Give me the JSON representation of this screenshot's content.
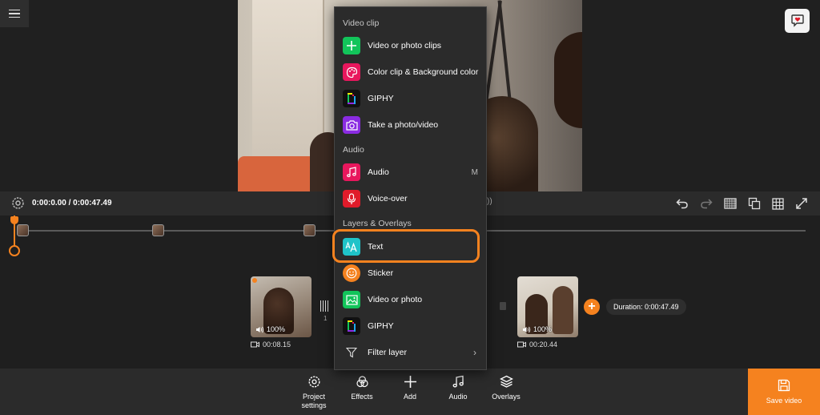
{
  "app": {
    "accent_color": "#f5821f"
  },
  "controls": {
    "time": "0:00:0.00 / 0:00:47.49",
    "volume_hint": "))"
  },
  "timeline": {
    "clips": [
      {
        "volume": "100%",
        "duration": "00:08.15"
      },
      {
        "volume": "100%",
        "duration": "00:20.44"
      }
    ],
    "transition_number": "1",
    "duration_label": "Duration: 0:00:47.49"
  },
  "add_menu": {
    "sections": [
      {
        "header": "Video clip",
        "items": [
          {
            "label": "Video or photo clips",
            "icon": "plus-icon",
            "color": "#12c45a"
          },
          {
            "label": "Color clip & Background color",
            "icon": "palette-icon",
            "color": "#e8175d"
          },
          {
            "label": "GIPHY",
            "icon": "giphy-icon",
            "color": "#111111"
          },
          {
            "label": "Take a photo/video",
            "icon": "camera-icon",
            "color": "#8a2be2"
          }
        ]
      },
      {
        "header": "Audio",
        "items": [
          {
            "label": "Audio",
            "icon": "music-note-icon",
            "color": "#e8175d",
            "shortcut": "M"
          },
          {
            "label": "Voice-over",
            "icon": "microphone-icon",
            "color": "#e01b2a"
          }
        ]
      },
      {
        "header": "Layers & Overlays",
        "items": [
          {
            "label": "Text",
            "icon": "text-icon",
            "color": "#1fc3c9"
          },
          {
            "label": "Sticker",
            "icon": "smiley-icon",
            "color": "#f5821f"
          },
          {
            "label": "Video or photo",
            "icon": "image-icon",
            "color": "#12c45a"
          },
          {
            "label": "GIPHY",
            "icon": "giphy-icon",
            "color": "#111111"
          },
          {
            "label": "Filter layer",
            "icon": "filter-icon",
            "color": "#2b2b2b"
          }
        ]
      }
    ]
  },
  "toolbar": {
    "items": [
      {
        "label": "Project settings",
        "icon": "gear-icon"
      },
      {
        "label": "Effects",
        "icon": "effects-icon"
      },
      {
        "label": "Add",
        "icon": "plus-icon"
      },
      {
        "label": "Audio",
        "icon": "music-note-icon"
      },
      {
        "label": "Overlays",
        "icon": "layers-icon"
      }
    ],
    "save_label": "Save video"
  }
}
